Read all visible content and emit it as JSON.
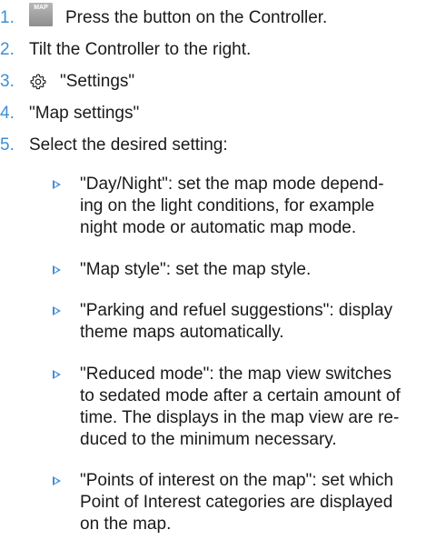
{
  "steps": [
    {
      "num": "1.",
      "icon": "map-button-icon",
      "icon_label": "MAP",
      "text": "Press the button on the Controller."
    },
    {
      "num": "2.",
      "text": "Tilt the Controller to the right."
    },
    {
      "num": "3.",
      "icon": "gear-icon",
      "text": "\"Settings\""
    },
    {
      "num": "4.",
      "text": "\"Map settings\""
    },
    {
      "num": "5.",
      "text": "Select the desired setting:"
    }
  ],
  "options": [
    {
      "lines": [
        "\"Day/Night\": set the map mode depend-",
        "ing on the light conditions, for example",
        "night mode or automatic map mode."
      ]
    },
    {
      "lines": [
        "\"Map style\": set the map style."
      ]
    },
    {
      "lines": [
        "\"Parking and refuel suggestions\": display",
        "theme maps automatically."
      ]
    },
    {
      "lines": [
        "\"Reduced mode\": the map view switches",
        "to sedated mode after a certain amount of",
        "time. The displays in the map view are re-",
        "duced to the minimum necessary."
      ]
    },
    {
      "lines": [
        "\"Points of interest on the map\": set which",
        "Point of Interest categories are displayed",
        "on the map."
      ]
    }
  ],
  "colors": {
    "accent": "#3d8fd6",
    "text": "#1a1a1a"
  }
}
